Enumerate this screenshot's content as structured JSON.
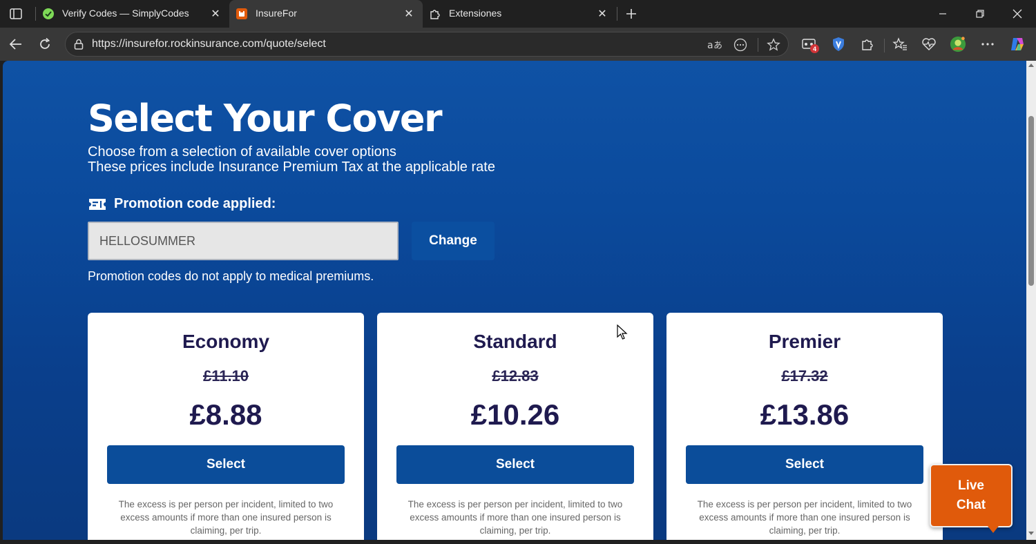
{
  "browser": {
    "tabs": [
      {
        "title": "Verify Codes — SimplyCodes",
        "favicon": "simplycodes-icon",
        "active": false
      },
      {
        "title": "InsureFor",
        "favicon": "insurefor-icon",
        "active": true
      },
      {
        "title": "Extensiones",
        "favicon": "extensions-icon",
        "active": false
      }
    ],
    "url": "https://insurefor.rockinsurance.com/quote/select",
    "extension_badge": "4"
  },
  "page": {
    "title": "Select Your Cover",
    "subtitle_lines": [
      "Choose from a selection of available cover options",
      "These prices include Insurance Premium Tax at the applicable rate"
    ],
    "promo": {
      "heading": "Promotion code applied:",
      "code": "HELLOSUMMER",
      "change_label": "Change",
      "note": "Promotion codes do not apply to medical premiums."
    },
    "plans": [
      {
        "name": "Economy",
        "old_price": "£11.10",
        "price": "£8.88",
        "select_label": "Select",
        "excess": "The excess is per person per incident, limited to two excess amounts if more than one insured person is claiming, per trip."
      },
      {
        "name": "Standard",
        "old_price": "£12.83",
        "price": "£10.26",
        "select_label": "Select",
        "excess": "The excess is per person per incident, limited to two excess amounts if more than one insured person is claiming, per trip."
      },
      {
        "name": "Premier",
        "old_price": "£17.32",
        "price": "£13.86",
        "select_label": "Select",
        "excess": "The excess is per person per incident, limited to two excess amounts if more than one insured person is claiming, per trip."
      }
    ],
    "live_chat": {
      "line1": "Live",
      "line2": "Chat"
    }
  },
  "colors": {
    "page_blue": "#0b4a9c",
    "button_blue": "#0b4d9a",
    "heading_navy": "#1f1a4f",
    "live_chat_orange": "#e05a0b"
  }
}
